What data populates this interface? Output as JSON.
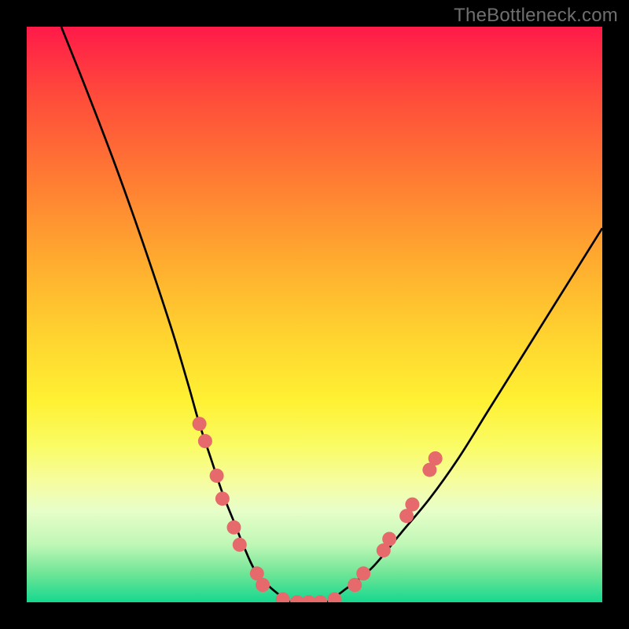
{
  "watermark": "TheBottleneck.com",
  "colors": {
    "frame": "#000000",
    "curve": "#000000",
    "dot": "#E66A6B",
    "gradient_top": "#ff1a49",
    "gradient_bottom": "#15d88f"
  },
  "chart_data": {
    "type": "line",
    "title": "",
    "xlabel": "",
    "ylabel": "",
    "xlim": [
      0,
      100
    ],
    "ylim": [
      0,
      100
    ],
    "series": [
      {
        "name": "bottleneck-curve",
        "x": [
          6,
          10,
          15,
          20,
          25,
          28,
          30,
          32,
          34,
          36,
          38,
          40,
          43,
          46,
          49,
          52,
          55,
          60,
          65,
          70,
          75,
          80,
          85,
          90,
          95,
          100
        ],
        "y_pct": [
          100,
          90,
          77,
          63,
          48,
          38,
          31,
          25,
          19,
          14,
          9,
          5,
          2,
          0,
          0,
          0,
          2,
          6,
          12,
          18,
          25,
          33,
          41,
          49,
          57,
          65
        ]
      }
    ],
    "markers": {
      "name": "highlight-dots",
      "points": [
        {
          "x": 30,
          "y_pct": 31
        },
        {
          "x": 31,
          "y_pct": 28
        },
        {
          "x": 33,
          "y_pct": 22
        },
        {
          "x": 34,
          "y_pct": 18
        },
        {
          "x": 36,
          "y_pct": 13
        },
        {
          "x": 37,
          "y_pct": 10
        },
        {
          "x": 40,
          "y_pct": 5
        },
        {
          "x": 41,
          "y_pct": 3
        },
        {
          "x": 44.5,
          "y_pct": 0.5
        },
        {
          "x": 47,
          "y_pct": 0
        },
        {
          "x": 49,
          "y_pct": 0
        },
        {
          "x": 51,
          "y_pct": 0
        },
        {
          "x": 53.5,
          "y_pct": 0.5
        },
        {
          "x": 57,
          "y_pct": 3
        },
        {
          "x": 58.5,
          "y_pct": 5
        },
        {
          "x": 62,
          "y_pct": 9
        },
        {
          "x": 63,
          "y_pct": 11
        },
        {
          "x": 66,
          "y_pct": 15
        },
        {
          "x": 67,
          "y_pct": 17
        },
        {
          "x": 70,
          "y_pct": 23
        },
        {
          "x": 71,
          "y_pct": 25
        }
      ]
    }
  }
}
